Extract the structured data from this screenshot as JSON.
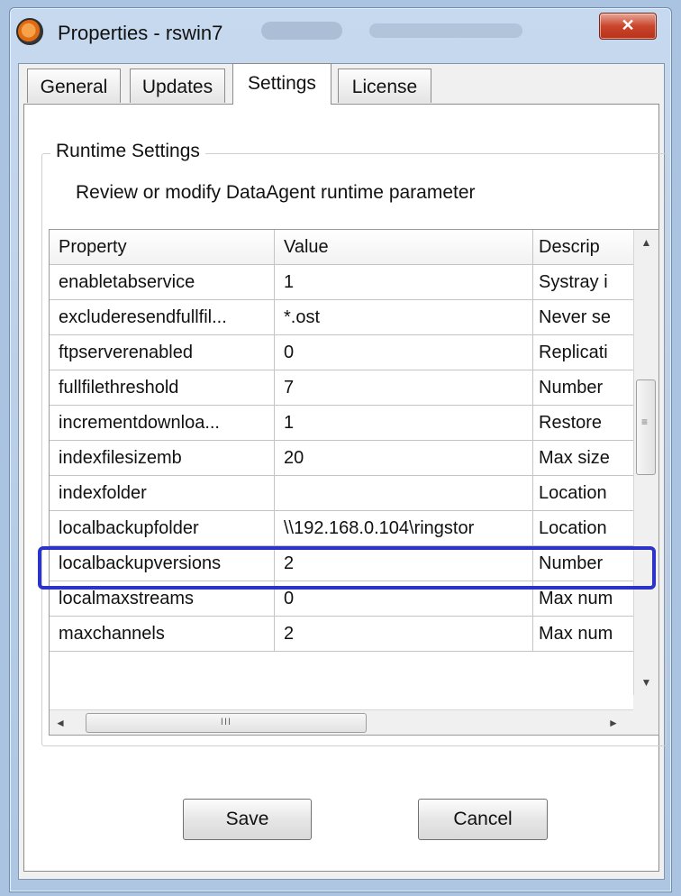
{
  "window": {
    "title": "Properties - rswin7",
    "close_glyph": "✕"
  },
  "tabs": [
    {
      "label": "General",
      "active": false
    },
    {
      "label": "Updates",
      "active": false
    },
    {
      "label": "Settings",
      "active": true
    },
    {
      "label": "License",
      "active": false
    }
  ],
  "group": {
    "title": "Runtime Settings",
    "description": "Review or modify DataAgent runtime parameter"
  },
  "table": {
    "columns": [
      "Property",
      "Value",
      "Descrip"
    ],
    "rows": [
      [
        "enabletabservice",
        "1",
        "Systray i"
      ],
      [
        "excluderesendfullfil...",
        "*.ost",
        "Never se"
      ],
      [
        "ftpserverenabled",
        "0",
        "Replicati"
      ],
      [
        "fullfilethreshold",
        "7",
        "Number"
      ],
      [
        "incrementdownloa...",
        "1",
        "Restore"
      ],
      [
        "indexfilesizemb",
        "20",
        "Max size"
      ],
      [
        "indexfolder",
        "",
        "Location"
      ],
      [
        "localbackupfolder",
        "\\\\192.168.0.104\\ringstor",
        "Location"
      ],
      [
        "localbackupversions",
        "2",
        "Number"
      ],
      [
        "localmaxstreams",
        "0",
        "Max num"
      ],
      [
        "maxchannels",
        "2",
        "Max num"
      ]
    ],
    "highlighted_row": "localbackupfolder"
  },
  "scrollbars": {
    "up_glyph": "▲",
    "down_glyph": "▼",
    "left_glyph": "◄",
    "right_glyph": "►",
    "grip_glyph": "III"
  },
  "buttons": {
    "save": "Save",
    "cancel": "Cancel"
  },
  "colors": {
    "highlight_border": "#2b33c9",
    "close_button": "#c9452b"
  },
  "icons": [
    "app-icon",
    "close-icon",
    "scroll-up-icon",
    "scroll-down-icon",
    "scroll-left-icon",
    "scroll-right-icon"
  ]
}
